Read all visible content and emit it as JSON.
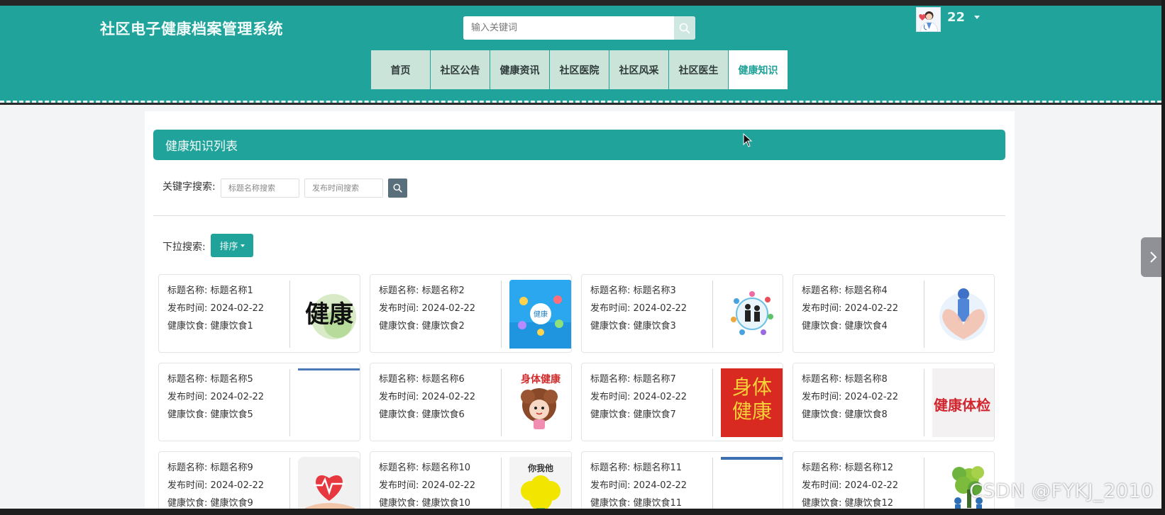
{
  "site": {
    "title": "社区电子健康档案管理系统"
  },
  "search": {
    "placeholder": "输入关键词"
  },
  "user": {
    "name": "22"
  },
  "nav": [
    {
      "label": "首页",
      "active": false
    },
    {
      "label": "社区公告",
      "active": false
    },
    {
      "label": "健康资讯",
      "active": false
    },
    {
      "label": "社区医院",
      "active": false
    },
    {
      "label": "社区风采",
      "active": false
    },
    {
      "label": "社区医生",
      "active": false
    },
    {
      "label": "健康知识",
      "active": true
    }
  ],
  "list": {
    "header": "健康知识列表",
    "keyword_label": "关键字搜索:",
    "title_search_placeholder": "标题名称搜索",
    "time_search_placeholder": "发布时间搜索",
    "dropdown_label": "下拉搜索:",
    "sort_label": "排序"
  },
  "cards": [
    {
      "title_label": "标题名称:",
      "title": "标题名称1",
      "time_label": "发布时间:",
      "time": "2024-02-22",
      "diet_label": "健康饮食:",
      "diet": "健康饮食1",
      "image_text": "健康"
    },
    {
      "title_label": "标题名称:",
      "title": "标题名称2",
      "time_label": "发布时间:",
      "time": "2024-02-22",
      "diet_label": "健康饮食:",
      "diet": "健康饮食2",
      "image_text": "健康"
    },
    {
      "title_label": "标题名称:",
      "title": "标题名称3",
      "time_label": "发布时间:",
      "time": "2024-02-22",
      "diet_label": "健康饮食:",
      "diet": "健康饮食3",
      "image_text": ""
    },
    {
      "title_label": "标题名称:",
      "title": "标题名称4",
      "time_label": "发布时间:",
      "time": "2024-02-22",
      "diet_label": "健康饮食:",
      "diet": "健康饮食4",
      "image_text": ""
    },
    {
      "title_label": "标题名称:",
      "title": "标题名称5",
      "time_label": "发布时间:",
      "time": "2024-02-22",
      "diet_label": "健康饮食:",
      "diet": "健康饮食5",
      "image_text": ""
    },
    {
      "title_label": "标题名称:",
      "title": "标题名称6",
      "time_label": "发布时间:",
      "time": "2024-02-22",
      "diet_label": "健康饮食:",
      "diet": "健康饮食6",
      "image_text": "身体健康"
    },
    {
      "title_label": "标题名称:",
      "title": "标题名称7",
      "time_label": "发布时间:",
      "time": "2024-02-22",
      "diet_label": "健康饮食:",
      "diet": "健康饮食7",
      "image_text": "身体健康"
    },
    {
      "title_label": "标题名称:",
      "title": "标题名称8",
      "time_label": "发布时间:",
      "time": "2024-02-22",
      "diet_label": "健康饮食:",
      "diet": "健康饮食8",
      "image_text": "健康体检"
    },
    {
      "title_label": "标题名称:",
      "title": "标题名称9",
      "time_label": "发布时间:",
      "time": "2024-02-22",
      "diet_label": "健康饮食:",
      "diet": "健康饮食9",
      "image_text": ""
    },
    {
      "title_label": "标题名称:",
      "title": "标题名称10",
      "time_label": "发布时间:",
      "time": "2024-02-22",
      "diet_label": "健康饮食:",
      "diet": "健康饮食10",
      "image_text": "你我他"
    },
    {
      "title_label": "标题名称:",
      "title": "标题名称11",
      "time_label": "发布时间:",
      "time": "2024-02-22",
      "diet_label": "健康饮食:",
      "diet": "健康饮食11",
      "image_text": ""
    },
    {
      "title_label": "标题名称:",
      "title": "标题名称12",
      "time_label": "发布时间:",
      "time": "2024-02-22",
      "diet_label": "健康饮食:",
      "diet": "健康饮食12",
      "image_text": ""
    }
  ],
  "watermark": "CSDN @FYKJ_2010",
  "colors": {
    "primary": "#20a39a",
    "nav_bg": "#cbe4d9",
    "nav_active_text": "#1da096",
    "search_btn": "#5a6f7c"
  }
}
